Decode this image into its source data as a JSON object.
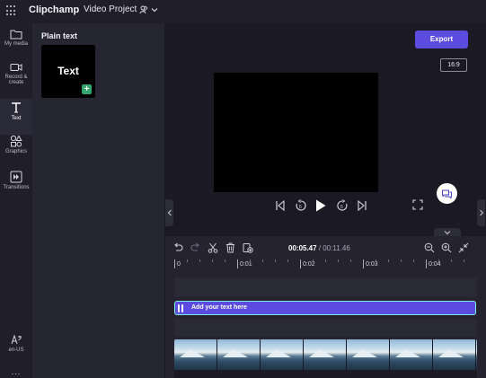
{
  "app": {
    "brand": "Clipchamp",
    "project_title": "Video Project"
  },
  "sidebar": {
    "items": [
      {
        "label": "My media",
        "icon": "folder-icon"
      },
      {
        "label": "Record & create",
        "icon": "camera-icon"
      },
      {
        "label": "Text",
        "icon": "text-icon",
        "active": true
      },
      {
        "label": "Graphics",
        "icon": "shapes-icon"
      },
      {
        "label": "Transitions",
        "icon": "transitions-icon"
      }
    ],
    "language": "en-US",
    "more": "..."
  },
  "panel": {
    "title": "Plain text",
    "card_label": "Text",
    "add_symbol": "+"
  },
  "preview": {
    "export_label": "Export",
    "aspect_ratio": "16:9"
  },
  "timeline": {
    "current_time": "00:05.47",
    "separator": " / ",
    "total_time": "00:11.46",
    "ruler_ticks": [
      "0",
      "0:01",
      "0:02",
      "0:03",
      "0:04"
    ],
    "text_clip_label": "Add your text here"
  },
  "colors": {
    "accent": "#5b4bdf",
    "clip_border": "#7cf0e6",
    "add_green": "#33a56f"
  }
}
